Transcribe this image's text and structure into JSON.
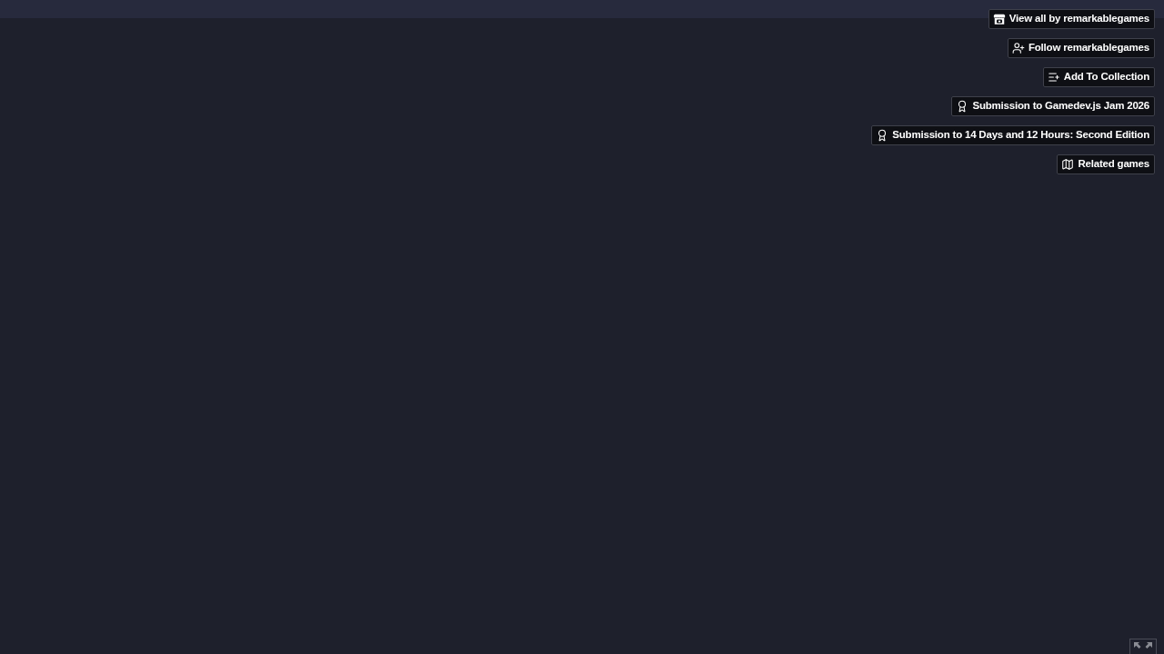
{
  "user_tools": [
    {
      "kind": "store",
      "label": "View all by remarkablegames"
    },
    {
      "kind": "follow",
      "label": "Follow remarkablegames"
    },
    {
      "kind": "collection",
      "label": "Add To Collection"
    },
    {
      "kind": "jam",
      "label": "Submission to Gamedev.js Jam 2026"
    },
    {
      "kind": "jam",
      "label": "Submission to 14 Days and 12 Hours: Second Edition"
    },
    {
      "kind": "related",
      "label": "Related games"
    }
  ]
}
